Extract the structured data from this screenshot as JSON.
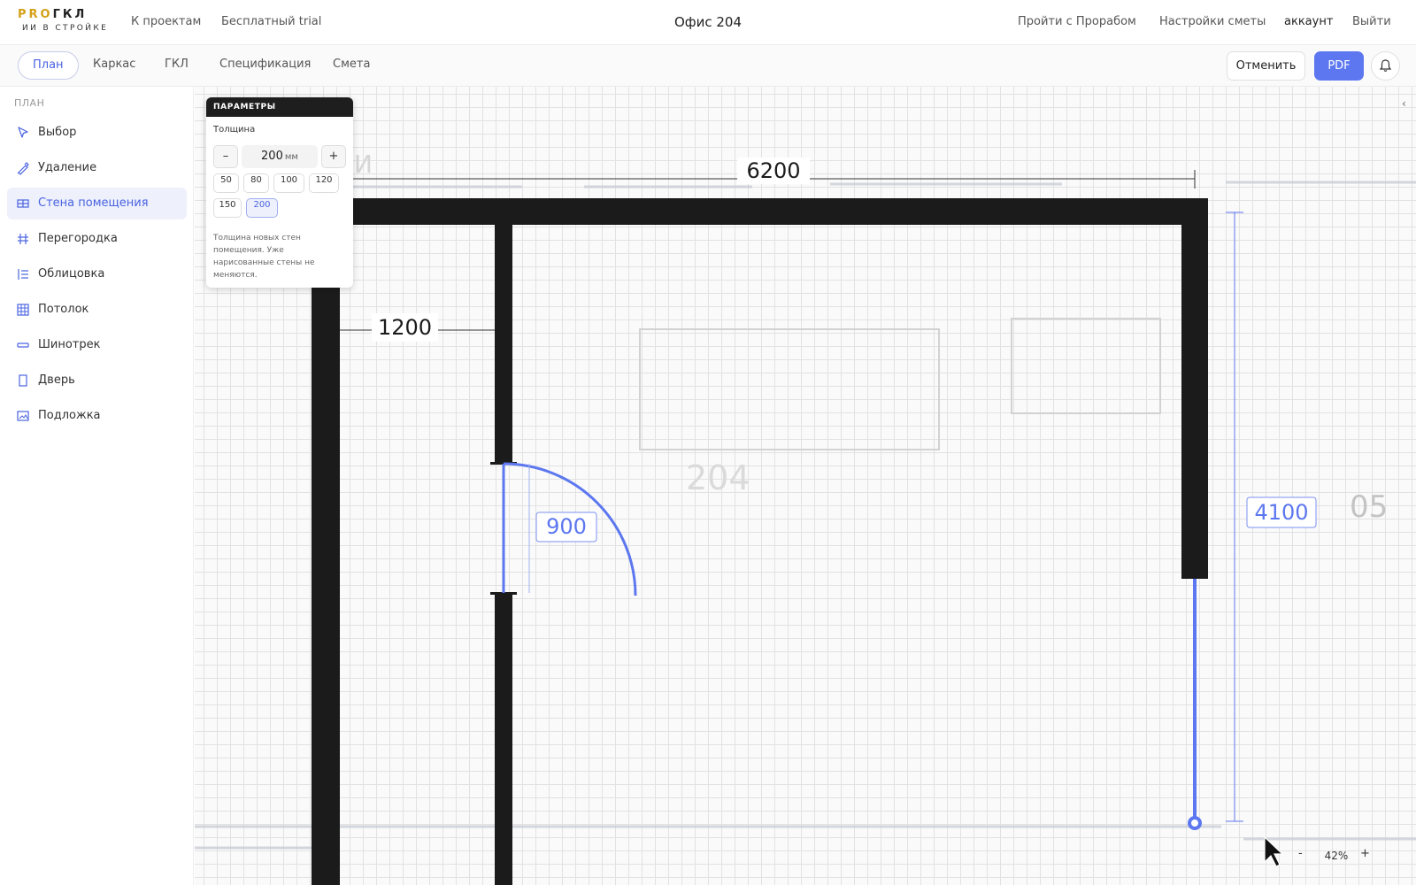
{
  "header": {
    "logo_pro": "PRO",
    "logo_gkl": "ГКЛ",
    "logo_sub": "ИИ В СТРОЙКЕ",
    "nav_projects": "К проектам",
    "nav_trial": "Бесплатный trial",
    "title": "Офис 204",
    "nav_prorab": "Пройти с Прорабом",
    "nav_settings": "Настройки сметы",
    "nav_account": "аккаунт",
    "nav_logout": "Выйти"
  },
  "tabs": [
    {
      "label": "План",
      "active": true
    },
    {
      "label": "Каркас",
      "active": false
    },
    {
      "label": "ГКЛ",
      "active": false
    },
    {
      "label": "Спецификация",
      "active": false
    },
    {
      "label": "Смета",
      "active": false
    }
  ],
  "toolbar": {
    "cancel_label": "Отменить",
    "pdf_label": "PDF",
    "bell_icon": "bell-icon"
  },
  "sidebar": {
    "heading": "ПЛАН",
    "items": [
      {
        "label": "Выбор",
        "icon": "cursor-icon",
        "active": false
      },
      {
        "label": "Удаление",
        "icon": "eraser-icon",
        "active": false
      },
      {
        "label": "Стена помещения",
        "icon": "room-wall-icon",
        "active": true
      },
      {
        "label": "Перегородка",
        "icon": "partition-icon",
        "active": false
      },
      {
        "label": "Облицовка",
        "icon": "cladding-icon",
        "active": false
      },
      {
        "label": "Потолок",
        "icon": "ceiling-grid-icon",
        "active": false
      },
      {
        "label": "Шинотрек",
        "icon": "busbar-icon",
        "active": false
      },
      {
        "label": "Дверь",
        "icon": "door-icon",
        "active": false
      },
      {
        "label": "Подложка",
        "icon": "underlay-image-icon",
        "active": false
      }
    ]
  },
  "params": {
    "heading": "ПАРАМЕТРЫ",
    "thickness_label": "Толщина",
    "minus": "–",
    "plus": "+",
    "value": "200",
    "unit": "мм",
    "presets": [
      "50",
      "80",
      "100",
      "120",
      "150",
      "200"
    ],
    "selected_preset": "200",
    "note": "Толщина новых стен помещения. Уже нарисованные стены не меняются."
  },
  "plan": {
    "dim_width": "6200",
    "dim_partition": "1200",
    "dim_door": "900",
    "dim_height": "4100",
    "room_number": "204",
    "neighbor_room_partial": "05",
    "neighbor_label_partial": "И"
  },
  "zoom": {
    "minus": "-",
    "value": "42%",
    "plus": "+"
  },
  "colors": {
    "accent": "#5c77ef",
    "wall": "#1b1b1b",
    "grid": "#e2e2e2"
  }
}
